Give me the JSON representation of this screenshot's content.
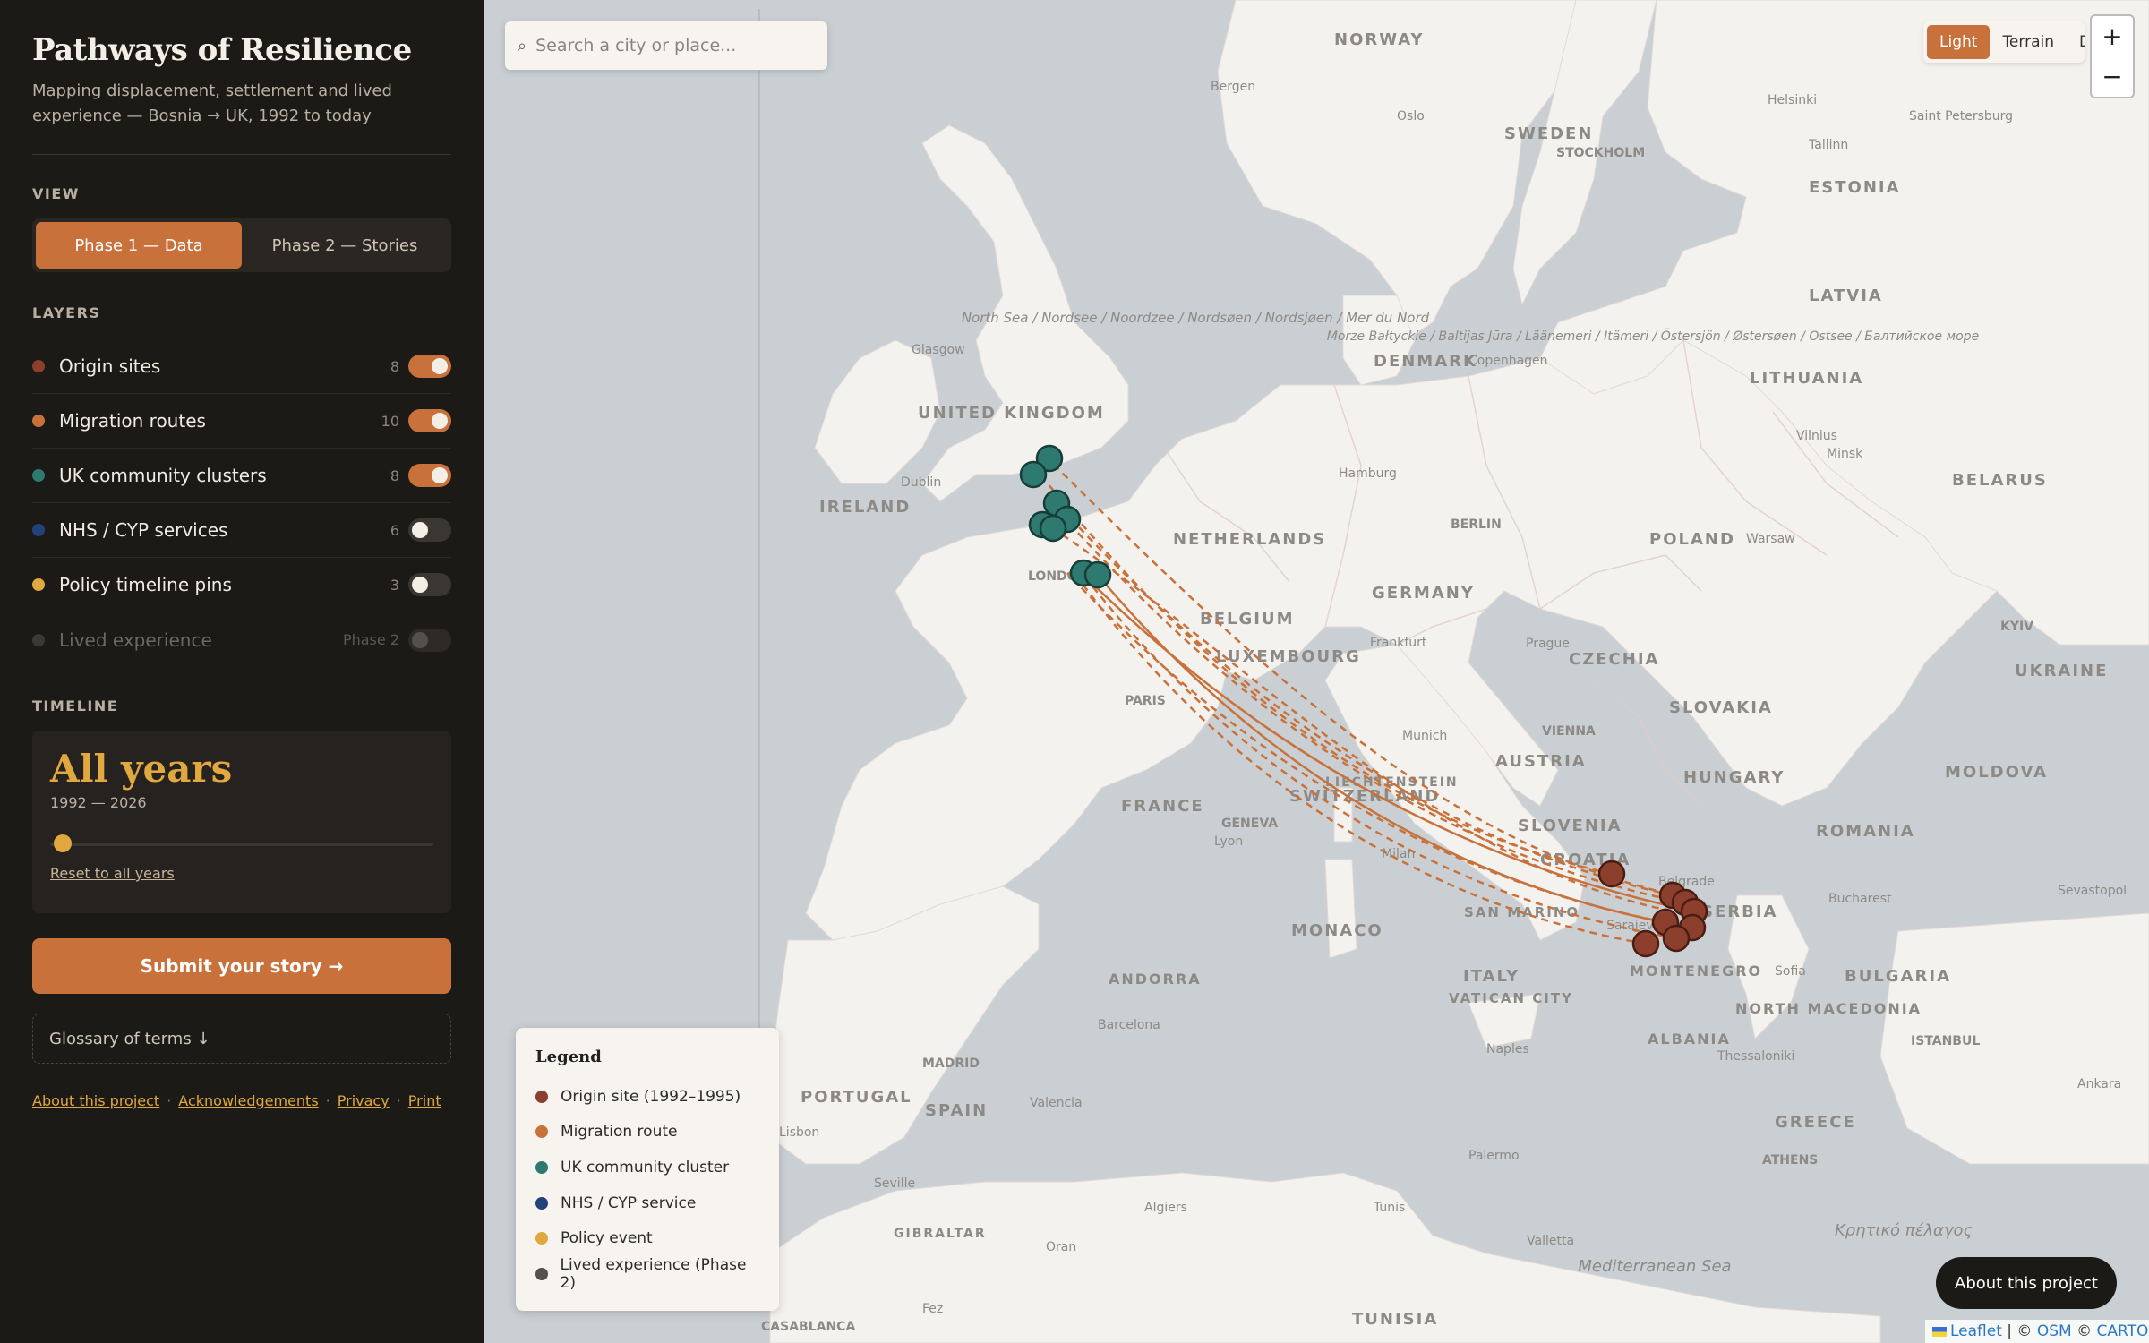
{
  "sidebar": {
    "title": "Pathways of Resilience",
    "subtitle": "Mapping displacement, settlement and lived experience — Bosnia → UK, 1992 to today",
    "view_label": "VIEW",
    "view_tabs": [
      {
        "label": "Phase 1 — Data",
        "active": true
      },
      {
        "label": "Phase 2 — Stories",
        "active": false
      }
    ],
    "layers_label": "LAYERS",
    "layers": [
      {
        "name": "Origin sites",
        "count": "8",
        "color": "#8c3f2c",
        "on": true
      },
      {
        "name": "Migration routes",
        "count": "10",
        "color": "#c8713b",
        "on": true
      },
      {
        "name": "UK community clusters",
        "count": "8",
        "color": "#2e7a70",
        "on": true
      },
      {
        "name": "NHS / CYP services",
        "count": "6",
        "color": "#23427a",
        "on": false
      },
      {
        "name": "Policy timeline pins",
        "count": "3",
        "color": "#e0a83e",
        "on": false
      },
      {
        "name": "Lived experience",
        "count": "Phase 2",
        "color": "#3c3832",
        "on": false
      }
    ],
    "timeline_label": "TIMELINE",
    "timeline": {
      "value": "All years",
      "range": "1992 — 2026",
      "reset": "Reset to all years",
      "slider_fraction": 0
    },
    "submit_label": "Submit your story →",
    "glossary_label": "Glossary of terms ↓",
    "footer_links": [
      "About this project",
      "Acknowledgements",
      "Privacy",
      "Print"
    ],
    "footer_sep": "·"
  },
  "map": {
    "search_placeholder": "Search a city or place...",
    "search_icon": "search-icon",
    "basemaps": [
      {
        "label": "Light",
        "active": true
      },
      {
        "label": "Terrain",
        "active": false
      },
      {
        "label": "Dark",
        "active": false
      }
    ],
    "zoom_in": "+",
    "zoom_out": "−",
    "legend": {
      "title": "Legend",
      "items": [
        {
          "label": "Origin site (1992–1995)",
          "color": "#8c3f2c"
        },
        {
          "label": "Migration route",
          "color": "#c8713b"
        },
        {
          "label": "UK community cluster",
          "color": "#2e7a70"
        },
        {
          "label": "NHS / CYP service",
          "color": "#23427a"
        },
        {
          "label": "Policy event",
          "color": "#e0a83e"
        },
        {
          "label": "Lived experience (Phase 2)",
          "color": "#55504a"
        }
      ]
    },
    "about_button": "About this project",
    "attribution": {
      "leaflet": "Leaflet",
      "sep1": " | © ",
      "osm": "OSM",
      "sep2": " © ",
      "carto": "CARTO"
    },
    "labels": {
      "countries": [
        "NORWAY",
        "SWEDEN",
        "ESTONIA",
        "LATVIA",
        "LITHUANIA",
        "BELARUS",
        "DENMARK",
        "UNITED KINGDOM",
        "IRELAND",
        "NETHERLANDS",
        "BELGIUM",
        "LUXEMBOURG",
        "GERMANY",
        "POLAND",
        "CZECHIA",
        "SLOVAKIA",
        "UKRAINE",
        "MOLDOVA",
        "AUSTRIA",
        "HUNGARY",
        "ROMANIA",
        "SLOVENIA",
        "CROATIA",
        "SERBIA",
        "BULGARIA",
        "FRANCE",
        "SWITZERLAND",
        "LIECHTENSTEIN",
        "MONACO",
        "SAN MARINO",
        "ITALY",
        "VATICAN CITY",
        "ANDORRA",
        "SPAIN",
        "PORTUGAL",
        "MONTENEGRO",
        "ALBANIA",
        "NORTH MACEDONIA",
        "GREECE",
        "TUNISIA",
        "GIBRALTAR"
      ],
      "cities": [
        "Bergen",
        "Oslo",
        "STOCKHOLM",
        "Helsinki",
        "Saint Petersburg",
        "Tallinn",
        "Glasgow",
        "Dublin",
        "Copenhagen",
        "Hamburg",
        "BERLIN",
        "Warsaw",
        "Vilnius",
        "Minsk",
        "LONDON",
        "Frankfurt",
        "Prague",
        "PARIS",
        "Munich",
        "VIENNA",
        "KYIV",
        "GENEVA",
        "Lyon",
        "Milan",
        "Belgrade",
        "Sarajevo",
        "Bucharest",
        "Sevastopol",
        "Sofia",
        "ISTANBUL",
        "Ankara",
        "Thessaloniki",
        "ATHENS",
        "Naples",
        "Palermo",
        "Barcelona",
        "MADRID",
        "Valencia",
        "Lisbon",
        "Seville",
        "Algiers",
        "Tunis",
        "Valletta",
        "Oran",
        "Fez",
        "CASABLANCA"
      ],
      "seas": [
        "North Sea / Nordsee / Noordzee / Nordsøen / Nordsjøen / Mer du Nord",
        "Morze Bałtyckie / Baltijas Jūra / Läänemeri / Itämeri / Östersjön / Østersøen / Ostsee / Балтийское море",
        "Mediterranean Sea",
        "Κρητικό πέλαγος"
      ]
    }
  }
}
